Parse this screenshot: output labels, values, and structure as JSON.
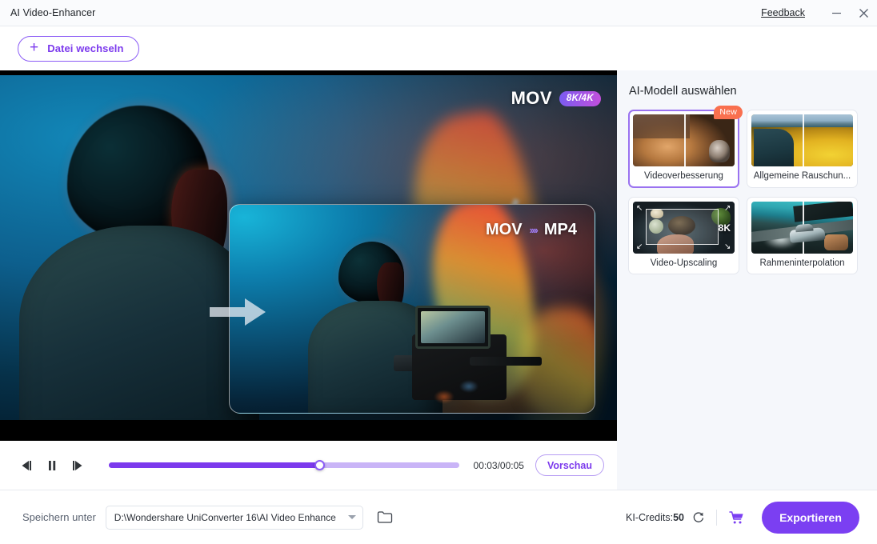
{
  "window": {
    "title": "AI Video-Enhancer",
    "feedback_label": "Feedback",
    "minimize_icon": "minimize-icon",
    "close_icon": "close-icon"
  },
  "toolbar": {
    "switch_file_label": "Datei wechseln",
    "plus_glyph": "+"
  },
  "player": {
    "source_format": "MOV",
    "resolution_badge": "8K/4K",
    "conversion_from": "MOV",
    "conversion_arrows": "››››",
    "conversion_to": "MP4",
    "controls": {
      "prev_frame_icon": "previous-frame-icon",
      "pause_icon": "pause-icon",
      "next_frame_icon": "next-frame-icon"
    },
    "time_display": "00:03/00:05",
    "current_time": "00:03",
    "total_time": "00:05",
    "progress_percent": 60,
    "preview_label": "Vorschau"
  },
  "side_panel": {
    "title": "AI-Modell auswählen",
    "new_badge": "New",
    "models": [
      {
        "label": "Videoverbesserung",
        "selected": true,
        "badge": "New",
        "thumb": "dog-thumb"
      },
      {
        "label": "Allgemeine Rauschun...",
        "selected": false,
        "badge": "",
        "thumb": "forest-thumb"
      },
      {
        "label": "Video-Upscaling",
        "selected": false,
        "badge": "",
        "thumb": "upscale-thumb",
        "overlay_text": "8K"
      },
      {
        "label": "Rahmeninterpolation",
        "selected": false,
        "badge": "",
        "thumb": "car-thumb"
      }
    ]
  },
  "footer": {
    "save_label": "Speichern unter",
    "save_path": "D:\\Wondershare UniConverter 16\\AI Video Enhance",
    "folder_icon": "folder-icon",
    "credits_label": "KI-Credits:",
    "credits_value": "50",
    "refresh_icon": "refresh-icon",
    "cart_icon": "shopping-cart-icon",
    "export_label": "Exportieren"
  },
  "colors": {
    "accent_purple": "#7b3ff2",
    "accent_purple_light": "#8b5cf6",
    "badge_new": "#f9704f",
    "panel_bg": "#f5f7fb",
    "titlebar_bg": "#fafbfd"
  }
}
